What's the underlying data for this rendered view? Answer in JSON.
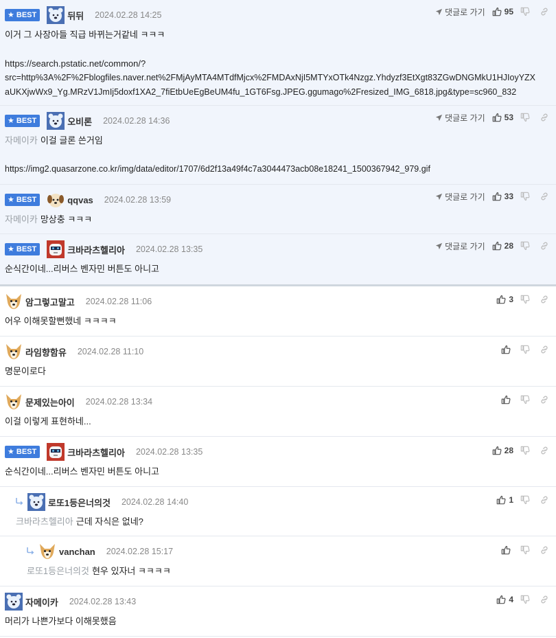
{
  "labels": {
    "best": "BEST",
    "reply_to": "댓글로 가기"
  },
  "colors": {
    "best_badge": "#3e7cdd",
    "best_bg": "#f1f5fc",
    "mention": "#9aa0a6"
  },
  "best_comments": [
    {
      "nick": "뒤뒤",
      "date": "2024.02.28 14:25",
      "likes": "95",
      "avatar": "bear-avatar",
      "mention": "",
      "lines": [
        "이거 그 사장아들 직급 바뀌는거같네 ㅋㅋㅋ",
        "",
        "https://search.pstatic.net/common/?",
        "src=http%3A%2F%2Fblogfiles.naver.net%2FMjAyMTA4MTdfMjcx%2FMDAxNjI5MTYxOTk4Nzgz.Yhdyzf3EtXgt83ZGwDNGMkU1HJIoyYZX",
        "aUKXjwWx9_Yg.MRzV1JmIj5doxf1XA2_7fiEtbUeEgBeUM4fu_1GT6Fsg.JPEG.ggumago%2Fresized_IMG_6818.jpg&type=sc960_832"
      ]
    },
    {
      "nick": "오비론",
      "date": "2024.02.28 14:36",
      "likes": "53",
      "avatar": "bear-avatar",
      "mention": "자메이카",
      "lines": [
        "이걸 글론 쓴거임",
        "",
        "https://img2.quasarzone.co.kr/img/data/editor/1707/6d2f13a49f4c7a3044473acb08e18241_1500367942_979.gif"
      ]
    },
    {
      "nick": "qqvas",
      "date": "2024.02.28 13:59",
      "likes": "33",
      "avatar": "puppy-avatar",
      "mention": "자메이카",
      "lines": [
        "망상충 ㅋㅋㅋ"
      ]
    },
    {
      "nick": "크바라츠헬리아",
      "date": "2024.02.28 13:35",
      "likes": "28",
      "avatar": "robot-avatar",
      "mention": "",
      "lines": [
        "순식간이네...리버스 벤자민 버튼도 아니고"
      ]
    }
  ],
  "comments": [
    {
      "nick": "암그렇고말고",
      "date": "2024.02.28 11:06",
      "likes": "3",
      "avatar": "dog-avatar",
      "best": false,
      "mention": "",
      "text": "어우 이해못할뻔했네 ㅋㅋㅋㅋ",
      "depth": 0
    },
    {
      "nick": "라임향함유",
      "date": "2024.02.28 11:10",
      "likes": "",
      "avatar": "dog-avatar",
      "best": false,
      "mention": "",
      "text": "명문이로다",
      "depth": 0
    },
    {
      "nick": "문제있는아이",
      "date": "2024.02.28 13:34",
      "likes": "",
      "avatar": "dog-avatar",
      "best": false,
      "mention": "",
      "text": "이걸 이렇게 표현하네...",
      "depth": 0
    },
    {
      "nick": "크바라츠헬리아",
      "date": "2024.02.28 13:35",
      "likes": "28",
      "avatar": "robot-avatar",
      "best": true,
      "mention": "",
      "text": "순식간이네...리버스 벤자민 버튼도 아니고",
      "depth": 0
    },
    {
      "nick": "로또1등은너의것",
      "date": "2024.02.28 14:40",
      "likes": "1",
      "avatar": "bear-avatar",
      "best": false,
      "mention": "크바라츠헬리아",
      "text": "근데 자식은 없네?",
      "depth": 1
    },
    {
      "nick": "vanchan",
      "date": "2024.02.28 15:17",
      "likes": "",
      "avatar": "dog-avatar",
      "best": false,
      "mention": "로또1등은너의것",
      "text": "현우 있자너 ㅋㅋㅋㅋ",
      "depth": 2
    },
    {
      "nick": "자메이카",
      "date": "2024.02.28 13:43",
      "likes": "4",
      "avatar": "bear-avatar",
      "best": false,
      "mention": "",
      "text": "머리가 나쁜가보다 이해못했음",
      "depth": 0
    }
  ]
}
